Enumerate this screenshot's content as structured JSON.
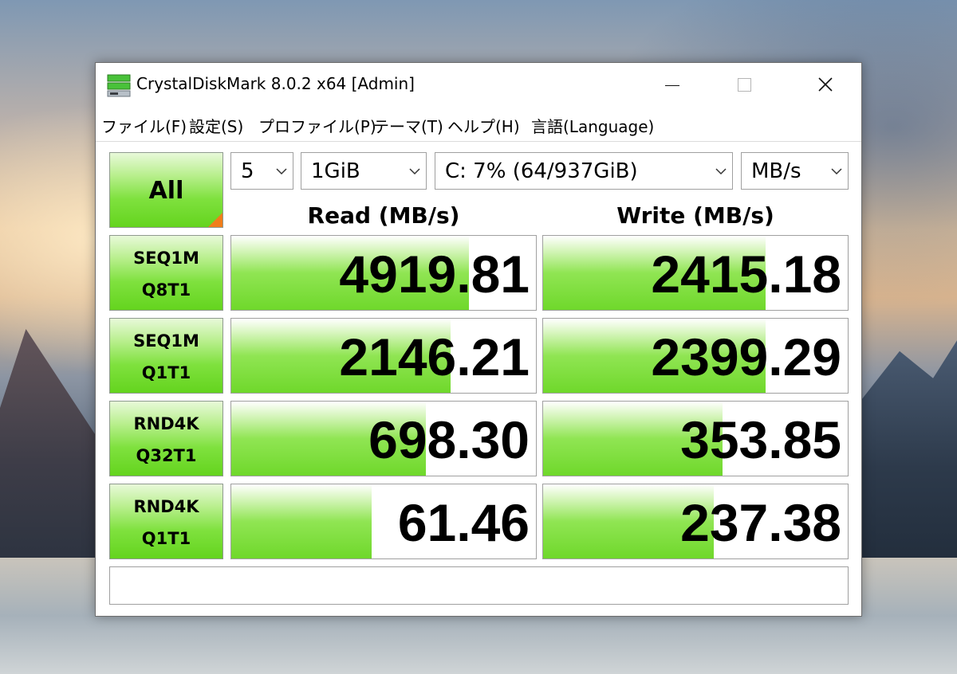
{
  "window": {
    "title": "CrystalDiskMark 8.0.2 x64 [Admin]"
  },
  "menu": {
    "items": [
      "ファイル(F)",
      "設定(S)",
      "プロファイル(P)",
      "テーマ(T)",
      "ヘルプ(H)",
      "言語(Language)"
    ]
  },
  "controls": {
    "all_button": "All",
    "count": "5",
    "size": "1GiB",
    "drive": "C: 7% (64/937GiB)",
    "unit": "MB/s"
  },
  "headers": {
    "read": "Read (MB/s)",
    "write": "Write (MB/s)"
  },
  "rows": [
    {
      "line1": "SEQ1M",
      "line2": "Q8T1",
      "read": "4919.81",
      "write": "2415.18",
      "read_fill": 0.78,
      "write_fill": 0.73
    },
    {
      "line1": "SEQ1M",
      "line2": "Q1T1",
      "read": "2146.21",
      "write": "2399.29",
      "read_fill": 0.72,
      "write_fill": 0.73
    },
    {
      "line1": "RND4K",
      "line2": "Q32T1",
      "read": "698.30",
      "write": "353.85",
      "read_fill": 0.64,
      "write_fill": 0.59
    },
    {
      "line1": "RND4K",
      "line2": "Q1T1",
      "read": "61.46",
      "write": "237.38",
      "read_fill": 0.46,
      "write_fill": 0.56
    }
  ],
  "status": "",
  "colors": {
    "bar_green": "#7fe13e",
    "corner_orange": "#f07d1a"
  }
}
